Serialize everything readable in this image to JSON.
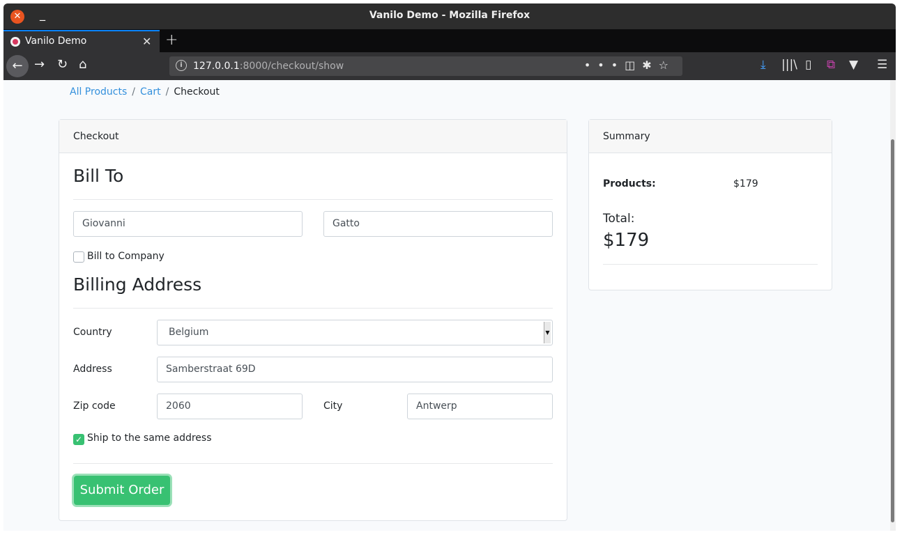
{
  "window": {
    "title": "Vanilo Demo - Mozilla Firefox"
  },
  "browser": {
    "tab_title": "Vanilo Demo",
    "url_host": "127.0.0.1",
    "url_path": ":8000/checkout/show"
  },
  "breadcrumb": {
    "items": [
      "All Products",
      "Cart",
      "Checkout"
    ],
    "separator": "/"
  },
  "checkout": {
    "header": "Checkout",
    "bill_to_heading": "Bill To",
    "first_name": "Giovanni",
    "last_name": "Gatto",
    "bill_to_company_label": "Bill to Company",
    "bill_to_company_checked": false,
    "billing_address_heading": "Billing Address",
    "country_label": "Country",
    "country_value": "Belgium",
    "address_label": "Address",
    "address_value": "Samberstraat 69D",
    "zip_label": "Zip code",
    "zip_value": "2060",
    "city_label": "City",
    "city_value": "Antwerp",
    "ship_same_label": "Ship to the same address",
    "ship_same_checked": true,
    "submit_label": "Submit Order"
  },
  "summary": {
    "header": "Summary",
    "products_label": "Products:",
    "products_value": "$179",
    "total_label": "Total:",
    "total_value": "$179"
  },
  "colors": {
    "primary_link": "#3490dc",
    "success": "#38c172",
    "firefox_accent": "#0a84ff"
  }
}
